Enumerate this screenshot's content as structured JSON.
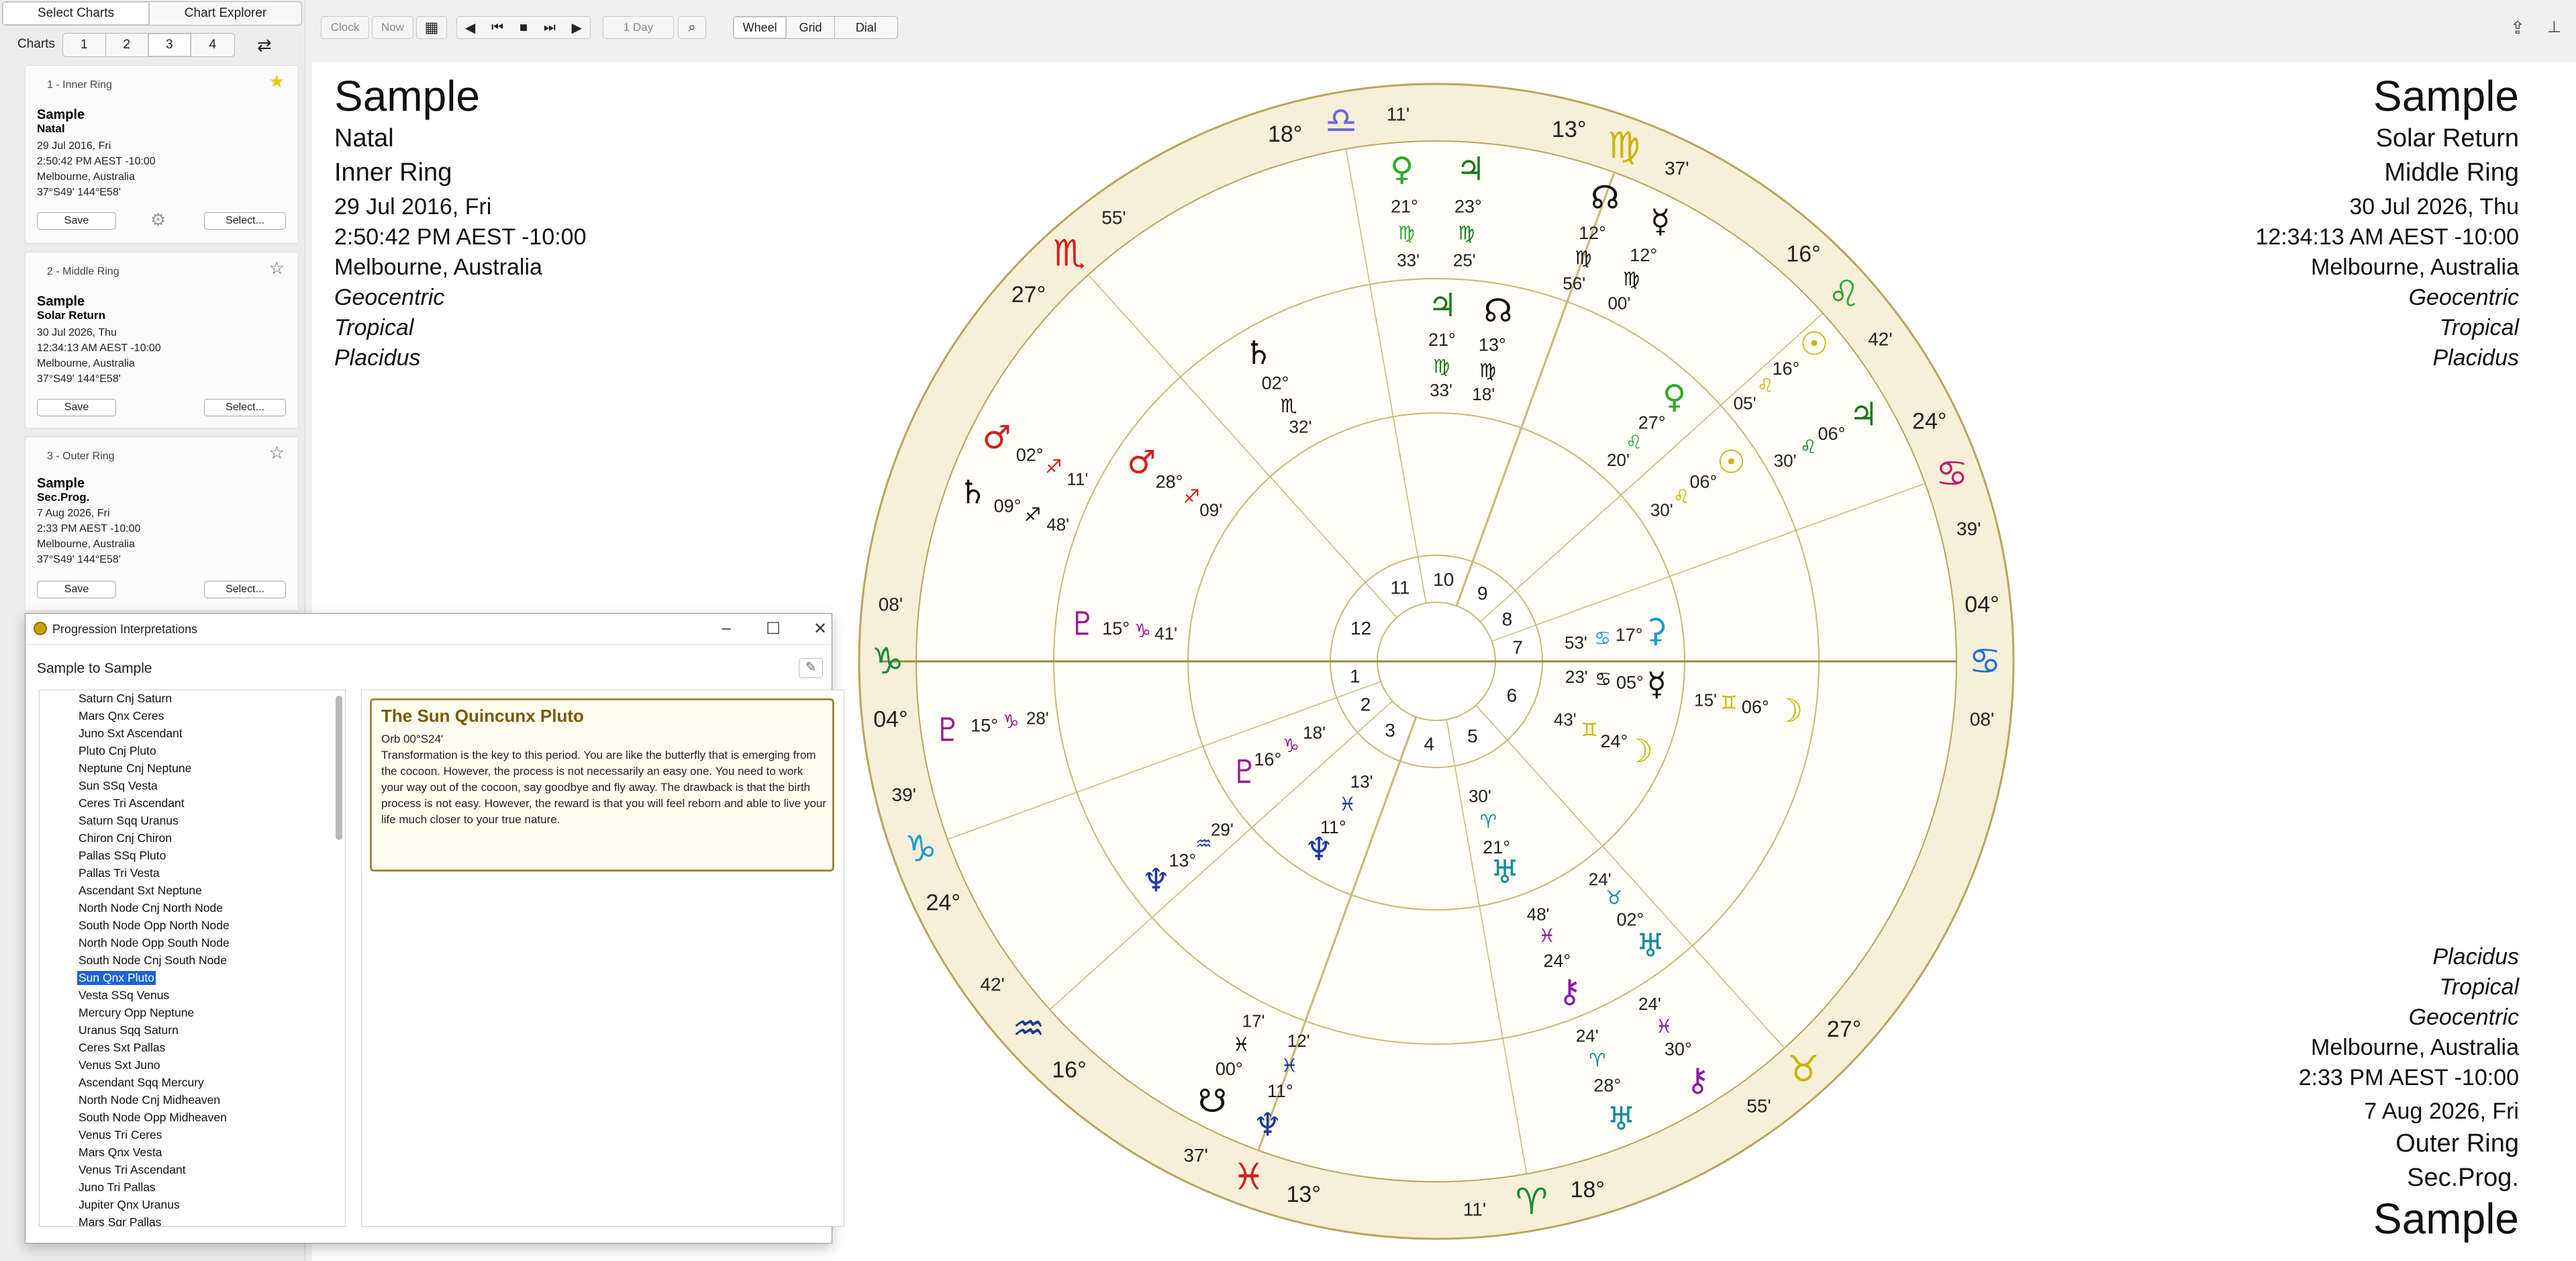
{
  "top_tabs": [
    "Select Charts",
    "Chart Explorer"
  ],
  "charts_label": "Charts",
  "chart_tabs": [
    "1",
    "2",
    "3",
    "4"
  ],
  "cards": [
    {
      "title": "1 - Inner Ring",
      "name": "Sample",
      "kind": "Natal",
      "date": "29 Jul 2016, Fri",
      "time": "2:50:42 PM AEST -10:00",
      "place": "Melbourne, Australia",
      "coords": "37°S49' 144°E58'",
      "save": "Save",
      "select": "Select..."
    },
    {
      "title": "2 - Middle Ring",
      "name": "Sample",
      "kind": "Solar Return",
      "date": "30 Jul 2026, Thu",
      "time": "12:34:13 AM AEST -10:00",
      "place": "Melbourne, Australia",
      "coords": "37°S49' 144°E58'",
      "save": "Save",
      "select": "Select..."
    },
    {
      "title": "3 - Outer Ring",
      "name": "Sample",
      "kind": "Sec.Prog.",
      "date": "7 Aug 2026, Fri",
      "time": "2:33 PM AEST -10:00",
      "place": "Melbourne, Australia",
      "coords": "37°S49' 144°E58'",
      "save": "Save",
      "select": "Select..."
    }
  ],
  "toolbar": {
    "clock": "Clock",
    "now": "Now",
    "step": "1 Day",
    "views": [
      "Wheel",
      "Grid",
      "Dial"
    ]
  },
  "left_header": {
    "name": "Sample",
    "kind": "Natal",
    "ring": "Inner Ring",
    "date": "29 Jul 2016, Fri",
    "time": "2:50:42 PM AEST -10:00",
    "place": "Melbourne, Australia",
    "centric": "Geocentric",
    "zodiac": "Tropical",
    "houses": "Placidus"
  },
  "right_header": {
    "name": "Sample",
    "kind": "Solar Return",
    "ring": "Middle Ring",
    "date": "30 Jul 2026, Thu",
    "time": "12:34:13 AM AEST -10:00",
    "place": "Melbourne, Australia",
    "centric": "Geocentric",
    "zodiac": "Tropical",
    "houses": "Placidus"
  },
  "outer_header": {
    "houses": "Placidus",
    "zodiac": "Tropical",
    "centric": "Geocentric",
    "place": "Melbourne, Australia",
    "time": "2:33 PM AEST -10:00",
    "date": "7 Aug 2026, Fri",
    "ring": "Outer Ring",
    "kind": "Sec.Prog.",
    "name": "Sample"
  },
  "dialog": {
    "title": "Progression Interpretations",
    "subtitle": "Sample to Sample",
    "items": [
      "Saturn Cnj Saturn",
      "Mars Qnx Ceres",
      "Juno Sxt Ascendant",
      "Pluto Cnj Pluto",
      "Neptune Cnj Neptune",
      "Sun SSq Vesta",
      "Ceres Tri Ascendant",
      "Saturn Sqq Uranus",
      "Chiron Cnj Chiron",
      "Pallas SSq Pluto",
      "Pallas Tri Vesta",
      "Ascendant Sxt Neptune",
      "North Node Cnj North Node",
      "South Node Opp North Node",
      "North Node Opp South Node",
      "South Node Cnj South Node",
      "Sun Qnx Pluto",
      "Vesta SSq Venus",
      "Mercury Opp Neptune",
      "Uranus Sqq Saturn",
      "Ceres Sxt Pallas",
      "Venus Sxt Juno",
      "Ascendant Sqq Mercury",
      "North Node Cnj Midheaven",
      "South Node Opp Midheaven",
      "Venus Tri Ceres",
      "Mars Qnx Vesta",
      "Venus Tri Ascendant",
      "Juno Tri Pallas",
      "Jupiter Qnx Uranus",
      "Mars Sqr Pallas"
    ],
    "selected_index": 16,
    "card_title": "The Sun Quincunx Pluto",
    "card_orb": "Orb 00°S24'",
    "card_body": "Transformation is the key to this period. You are like the butterfly that is emerging from the cocoon. However, the process is not necessarily an easy one. You need to work your way out of the cocoon, say goodbye and fly away. The drawback is that the birth process is not easy. However, the reward is that you will feel reborn and able to live your life much closer to your true nature."
  },
  "wheel": {
    "house_numbers": [
      "1",
      "2",
      "3",
      "4",
      "5",
      "6",
      "7",
      "8",
      "9",
      "10",
      "11",
      "12"
    ],
    "zodiac_glyphs": [
      "♑",
      "♒",
      "♓",
      "♈",
      "♉",
      "♊",
      "♋",
      "♌",
      "♍",
      "♎",
      "♏",
      "♐"
    ],
    "cusps": [
      {
        "deg": "04°",
        "sign": "♑",
        "min": "08'"
      },
      {
        "deg": "24°",
        "sign": "♑",
        "min": "39'"
      },
      {
        "deg": "16°",
        "sign": "♒",
        "min": "42'"
      },
      {
        "deg": "13°",
        "sign": "♓",
        "min": "37'"
      },
      {
        "deg": "18°",
        "sign": "♈",
        "min": "11'"
      },
      {
        "deg": "27°",
        "sign": "♉",
        "min": "55'"
      },
      {
        "deg": "04°",
        "sign": "♋",
        "min": "08'"
      },
      {
        "deg": "24°",
        "sign": "♋",
        "min": "39'"
      },
      {
        "deg": "16°",
        "sign": "♌",
        "min": "42'"
      },
      {
        "deg": "13°",
        "sign": "♍",
        "min": "37'"
      },
      {
        "deg": "18°",
        "sign": "♎",
        "min": "11'"
      },
      {
        "deg": "27°",
        "sign": "♏",
        "min": "55'"
      }
    ],
    "outer_planets": [
      {
        "glyph": "♃",
        "deg": "23°",
        "sign": "♍",
        "min": "25'"
      },
      {
        "glyph": "♀",
        "deg": "21°",
        "sign": "♍",
        "min": "33'"
      },
      {
        "glyph": "☊",
        "deg": "12°",
        "sign": "♍",
        "min": "56'"
      },
      {
        "glyph": "☿",
        "deg": "12°",
        "sign": "♍",
        "min": "00'"
      },
      {
        "glyph": "☉",
        "deg": "16°",
        "sign": "♌",
        "min": "05'"
      },
      {
        "glyph": "♃",
        "deg": "06°",
        "sign": "♌",
        "min": "30'"
      },
      {
        "glyph": "♂",
        "deg": "02°",
        "sign": "♐",
        "min": "11'"
      },
      {
        "glyph": "♄",
        "deg": "09°",
        "sign": "♐",
        "min": "48'"
      },
      {
        "glyph": "♇",
        "deg": "15°",
        "sign": "♑",
        "min": "28'"
      },
      {
        "glyph": "♆",
        "deg": "11°",
        "sign": "♓",
        "min": "12'"
      },
      {
        "glyph": "☋",
        "deg": "00°",
        "sign": "♓",
        "min": "17'"
      },
      {
        "glyph": "♅",
        "deg": "28°",
        "sign": "♈",
        "min": "24'"
      },
      {
        "glyph": "⚷",
        "deg": "30°",
        "sign": "♓",
        "min": "24'"
      }
    ],
    "middle_planets": [
      {
        "glyph": "♃",
        "deg": "21°",
        "sign": "♍",
        "min": "33'"
      },
      {
        "glyph": "☊",
        "deg": "13°",
        "sign": "♍",
        "min": "18'"
      },
      {
        "glyph": "♄",
        "deg": "02°",
        "sign": "♏",
        "min": "32'"
      },
      {
        "glyph": "♂",
        "deg": "28°",
        "sign": "♐",
        "min": "09'"
      },
      {
        "glyph": "♇",
        "deg": "15°",
        "sign": "♑",
        "min": "41'"
      },
      {
        "glyph": "♆",
        "deg": "13°",
        "sign": "♒",
        "min": "29'"
      },
      {
        "glyph": "☉",
        "deg": "06°",
        "sign": "♌",
        "min": "30'"
      },
      {
        "glyph": "♀",
        "deg": "27°",
        "sign": "♌",
        "min": "20'"
      },
      {
        "glyph": "☽",
        "deg": "06°",
        "sign": "♊",
        "min": "15'"
      },
      {
        "glyph": "♅",
        "deg": "02°",
        "sign": "♉",
        "min": "24'"
      },
      {
        "glyph": "⚷",
        "deg": "24°",
        "sign": "♓",
        "min": "48'"
      }
    ],
    "inner_planets": [
      {
        "glyph": "♆",
        "deg": "11°",
        "sign": "♓",
        "min": "13'"
      },
      {
        "glyph": "♇",
        "deg": "16°",
        "sign": "♑",
        "min": "18'"
      },
      {
        "glyph": "♅",
        "deg": "21°",
        "sign": "♈",
        "min": "30'"
      },
      {
        "glyph": "☿",
        "deg": "05°",
        "sign": "♋",
        "min": "23'"
      },
      {
        "glyph": "⚳",
        "deg": "17°",
        "sign": "♋",
        "min": "53'"
      },
      {
        "glyph": "☽",
        "deg": "24°",
        "sign": "♊",
        "min": "43'"
      }
    ]
  }
}
